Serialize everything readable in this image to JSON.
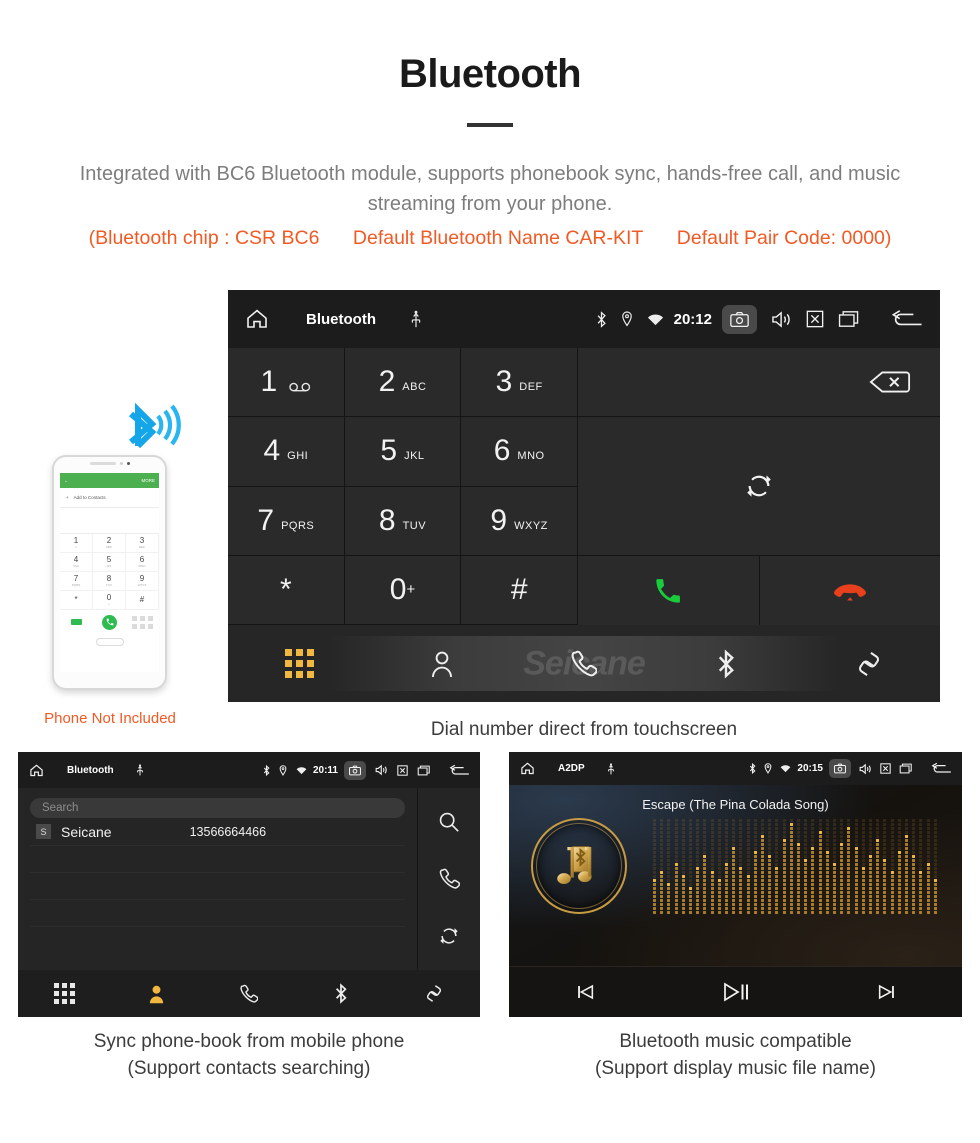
{
  "header": {
    "title": "Bluetooth",
    "intro": "Integrated with BC6 Bluetooth module, supports phonebook sync, hands-free call, and music streaming from your phone.",
    "spec_chip": "(Bluetooth chip : CSR BC6",
    "spec_name": "Default Bluetooth Name CAR-KIT",
    "spec_pair": "Default Pair Code: 0000)",
    "accent_color": "#f15a24",
    "text_color": "#7d7d7d"
  },
  "dialer": {
    "statusbar": {
      "home_icon": "home-icon",
      "title": "Bluetooth",
      "usb_icon": "usb-icon",
      "bluetooth_icon": "bluetooth-icon",
      "location_icon": "location-pin-icon",
      "wifi_icon": "wifi-icon",
      "time": "20:12",
      "camera_icon": "camera-icon",
      "volume_icon": "volume-icon",
      "close_icon": "close-box-icon",
      "recents_icon": "recent-apps-icon",
      "back_icon": "back-arrow-icon"
    },
    "keys": [
      {
        "digit": "1",
        "letters": "",
        "icon": "voicemail-icon"
      },
      {
        "digit": "2",
        "letters": "ABC",
        "icon": ""
      },
      {
        "digit": "3",
        "letters": "DEF",
        "icon": ""
      },
      {
        "digit": "4",
        "letters": "GHI",
        "icon": ""
      },
      {
        "digit": "5",
        "letters": "JKL",
        "icon": ""
      },
      {
        "digit": "6",
        "letters": "MNO",
        "icon": ""
      },
      {
        "digit": "7",
        "letters": "PQRS",
        "icon": ""
      },
      {
        "digit": "8",
        "letters": "TUV",
        "icon": ""
      },
      {
        "digit": "9",
        "letters": "WXYZ",
        "icon": ""
      },
      {
        "digit": "*",
        "letters": "",
        "icon": ""
      },
      {
        "digit": "0",
        "letters": "",
        "icon": "plus-superscript"
      },
      {
        "digit": "#",
        "letters": "",
        "icon": ""
      }
    ],
    "backspace_icon": "backspace-icon",
    "sync_icon": "sync-icon",
    "call_icon": "call-answer-icon",
    "call_color": "#19cc3c",
    "hangup_icon": "call-hangup-icon",
    "hangup_color": "#e8401c",
    "watermark": "Seicane",
    "navbar": {
      "active_color": "#f0b840",
      "items": [
        {
          "name": "dialpad",
          "icon": "dialpad-icon",
          "active": true
        },
        {
          "name": "contacts",
          "icon": "contacts-person-icon",
          "active": false
        },
        {
          "name": "call-log",
          "icon": "handset-icon",
          "active": false
        },
        {
          "name": "bluetooth",
          "icon": "bluetooth-icon",
          "active": false
        },
        {
          "name": "pair-link",
          "icon": "link-chain-icon",
          "active": false
        }
      ]
    },
    "caption": "Dial number direct from touchscreen"
  },
  "phone_mock": {
    "app_back_icon": "back-arrow-icon",
    "app_more_label": "MORE",
    "add_contact_label": "Add to Contacts",
    "add_plus": "+",
    "keys": [
      {
        "digit": "1",
        "letters": "∞"
      },
      {
        "digit": "2",
        "letters": "ABC"
      },
      {
        "digit": "3",
        "letters": "DEF"
      },
      {
        "digit": "4",
        "letters": "GHI"
      },
      {
        "digit": "5",
        "letters": "JKL"
      },
      {
        "digit": "6",
        "letters": "MNO"
      },
      {
        "digit": "7",
        "letters": "PQRS"
      },
      {
        "digit": "8",
        "letters": "TUV"
      },
      {
        "digit": "9",
        "letters": "WXYZ"
      },
      {
        "digit": "*",
        "letters": ""
      },
      {
        "digit": "0",
        "letters": "+"
      },
      {
        "digit": "#",
        "letters": ""
      }
    ],
    "note": "Phone Not Included",
    "note_color": "#f15a24",
    "bluetooth_logo_color": "#14a6e8"
  },
  "phonebook": {
    "statusbar": {
      "title": "Bluetooth",
      "time": "20:11"
    },
    "search_placeholder": "Search",
    "contacts": [
      {
        "initial": "S",
        "name": "Seicane",
        "number": "13566664466"
      }
    ],
    "side_icons": [
      "search-icon",
      "handset-icon",
      "sync-icon"
    ],
    "navbar": {
      "active_color": "#f0b840",
      "items": [
        {
          "name": "dialpad",
          "icon": "dialpad-icon",
          "active": false
        },
        {
          "name": "contacts",
          "icon": "contacts-person-icon",
          "active": true
        },
        {
          "name": "call-log",
          "icon": "handset-icon",
          "active": false
        },
        {
          "name": "bluetooth",
          "icon": "bluetooth-icon",
          "active": false
        },
        {
          "name": "pair-link",
          "icon": "link-chain-icon",
          "active": false
        }
      ]
    },
    "caption_line1": "Sync phone-book from mobile phone",
    "caption_line2": "(Support contacts searching)"
  },
  "music": {
    "statusbar": {
      "title": "A2DP",
      "time": "20:15"
    },
    "track_title": "Escape (The Pina Colada Song)",
    "album_icon": "music-note-bluetooth-icon",
    "accent_gold": "#c79b41",
    "controls": [
      {
        "name": "previous",
        "icon": "skip-previous-icon"
      },
      {
        "name": "play-pause",
        "icon": "play-pause-icon"
      },
      {
        "name": "next",
        "icon": "skip-next-icon"
      }
    ],
    "caption_line1": "Bluetooth music compatible",
    "caption_line2": "(Support display music file name)"
  }
}
